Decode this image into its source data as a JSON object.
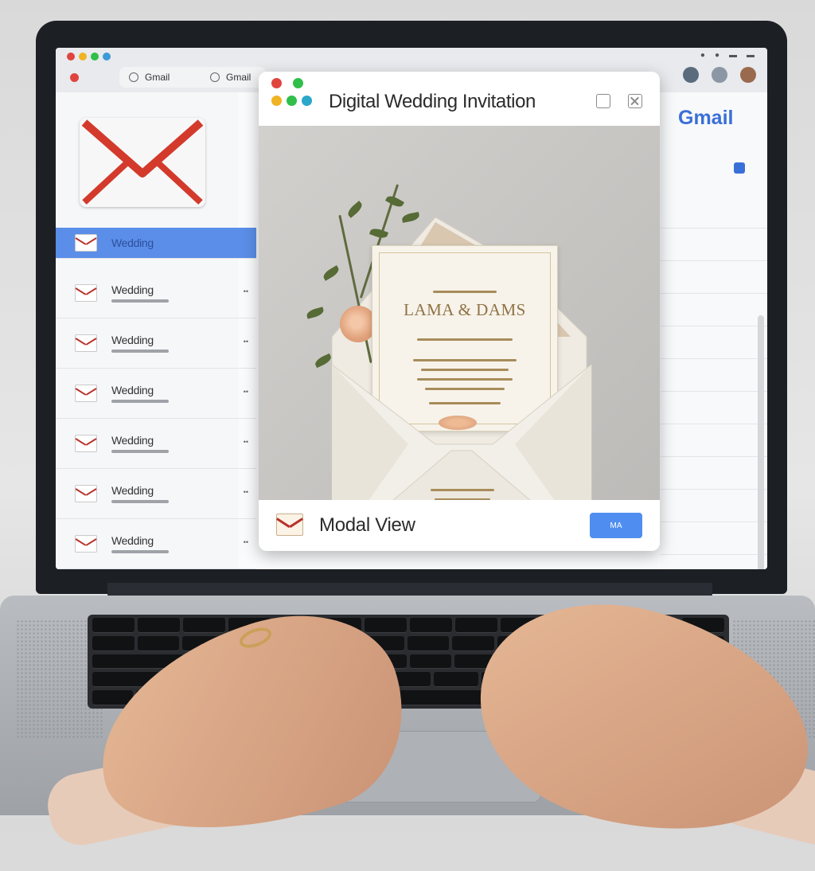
{
  "browser": {
    "tabs": [
      {
        "label": "Gmail"
      },
      {
        "label": "Gmail"
      }
    ],
    "window_dots": [
      "#e0443e",
      "#f0b323",
      "#2fbf4a",
      "#e0443e"
    ]
  },
  "app": {
    "brand": "Gmail",
    "accent_color": "#3a6fd8",
    "selected_row_color": "#5b8ee8"
  },
  "mail_list": {
    "items": [
      {
        "subject": "Wedding",
        "selected": true
      },
      {
        "subject": "Wedding"
      },
      {
        "subject": "Wedding"
      },
      {
        "subject": "Wedding"
      },
      {
        "subject": "Wedding"
      },
      {
        "subject": "Wedding"
      },
      {
        "subject": "Wedding"
      }
    ]
  },
  "modal": {
    "title": "Digital Wedding Invitation",
    "dot_colors_top": [
      "#e0443e",
      "#2fbf4a"
    ],
    "dot_colors_bottom": [
      "#f0b323",
      "#2fbf4a",
      "#2aa7c9"
    ],
    "card": {
      "names": "LAMA & DAMS"
    },
    "footer": {
      "label": "Modal View",
      "button_label": "MA"
    }
  },
  "icons": {
    "mail": "envelope-icon",
    "minimize": "minimize-icon",
    "close": "close-icon"
  }
}
